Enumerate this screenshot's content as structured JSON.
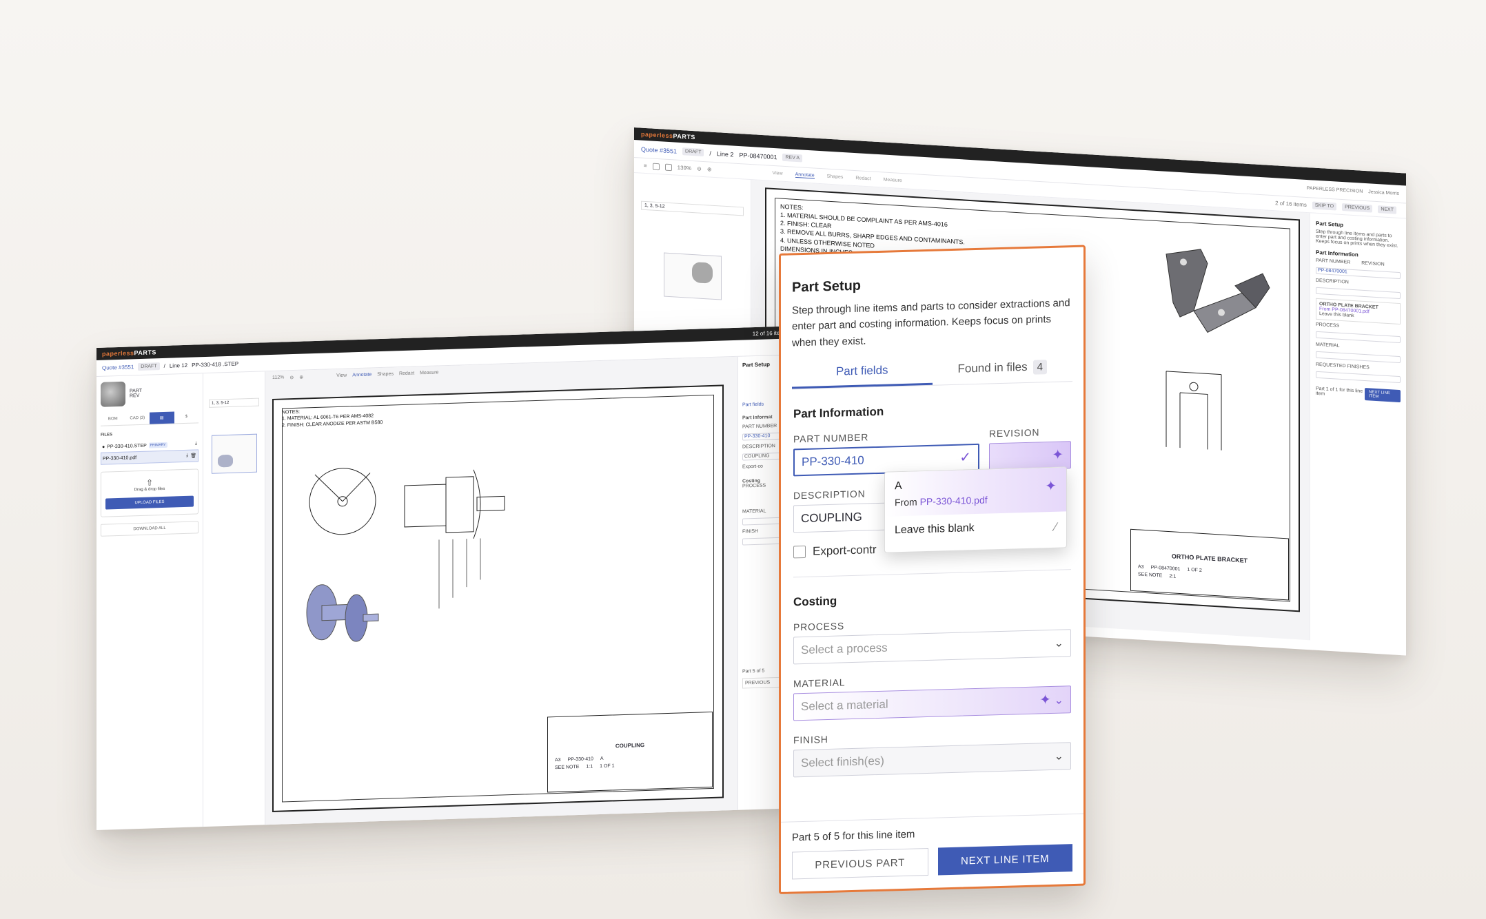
{
  "brand": {
    "logo_prefix": "paperless",
    "logo_suffix": "PARTS"
  },
  "back_window": {
    "quote": "Quote #3551",
    "status": "DRAFT",
    "line": "Line 2",
    "part_ref": "PP-08470001",
    "rev": "REV A",
    "org": "PAPERLESS PRECISION",
    "user": "Jessica Morris",
    "item_count": "2 of 16 items",
    "zoom": "139%",
    "nav_prev": "PREVIOUS",
    "nav_next": "NEXT",
    "skip_to": "SKIP TO",
    "page_field": "1, 3, 5-12",
    "tabs": [
      "View",
      "Annotate",
      "Shapes",
      "Redact",
      "Measure"
    ],
    "notes": [
      "NOTES:",
      "1. MATERIAL SHOULD BE COMPLAINT AS PER AMS-4016",
      "2. FINISH: CLEAR",
      "3. REMOVE ALL BURRS, SHARP EDGES AND CONTAMINANTS.",
      "4. UNLESS OTHERWISE NOTED",
      "   DIMENSIONS IN INCHES"
    ],
    "title_block": {
      "name": "ORTHO PLATE BRACKET",
      "part": "PP-08470001",
      "sheet": "1 OF 2",
      "size": "A3",
      "scale": "2:1",
      "note": "SEE NOTE"
    },
    "side": {
      "title": "Part Setup",
      "desc": "Step through line items and parts to enter part and costing information. Keeps focus on prints when they exist.",
      "section": "Part Information",
      "part_number_label": "PART NUMBER",
      "revision_label": "REVISION",
      "part_number": "PP-08470001",
      "revision": "A",
      "description_label": "DESCRIPTION",
      "suggest": "ORTHO PLATE BRACKET",
      "suggest_from": "From PP-08470001.pdf",
      "leave_blank": "Leave this blank",
      "process_label": "PROCESS",
      "material_label": "MATERIAL",
      "finish_label": "REQUESTED FINISHES",
      "footer": "Part 1 of 1 for this line item",
      "next": "NEXT LINE ITEM"
    }
  },
  "front_window": {
    "quote": "Quote #3551",
    "status": "DRAFT",
    "line": "Line 12",
    "part_ref": "PP-330-418 .STEP",
    "item_count": "12 of 16 items",
    "zoom": "112%",
    "page_field": "1, 3, 5-12",
    "tabs": [
      "View",
      "Annotate",
      "Shapes",
      "Redact",
      "Measure"
    ],
    "part_label": "PART",
    "rev_label": "REV",
    "left_tabs": [
      "BOM",
      "CAD (3)",
      "",
      "$"
    ],
    "files_header": "FILES",
    "files": [
      {
        "name": "PP-330-410.STEP",
        "badge": "PRIMARY"
      },
      {
        "name": "PP-330-410.pdf",
        "badge": ""
      }
    ],
    "dropzone_text": "Drag & drop files",
    "upload_label": "UPLOAD FILES",
    "download_all": "DOWNLOAD ALL",
    "notes": [
      "NOTES:",
      "1.    MATERIAL: AL 6061-T6 PER AMS-4082",
      "2.    FINISH: CLEAR ANODIZE PER ASTM B580"
    ],
    "title_block": {
      "name": "COUPLING",
      "part": "PP-330-410",
      "rev": "A",
      "size": "A3",
      "scale": "1:1",
      "sheet": "1 OF 1",
      "note": "SEE NOTE"
    },
    "side": {
      "title": "Part Setup",
      "tab": "Part fields",
      "info": "Part Informat",
      "pn": "PART NUMBER",
      "pn_val": "PP-330-410",
      "desc": "DESCRIPTION",
      "desc_val": "COUPLING",
      "export": "Export-co",
      "costing": "Costing",
      "process": "PROCESS",
      "material": "MATERIAL",
      "finish": "FINISH",
      "footer": "Part 5 of 5",
      "prev": "PREVIOUS"
    }
  },
  "panel": {
    "title": "Part Setup",
    "description": "Step through line items and parts to consider extractions and enter part and costing information. Keeps focus on prints when they exist.",
    "tabs": [
      {
        "label": "Part fields",
        "active": true
      },
      {
        "label": "Found in files",
        "count": "4",
        "active": false
      }
    ],
    "part_info_header": "Part Information",
    "part_number_label": "PART NUMBER",
    "part_number_value": "PP-330-410",
    "revision_label": "REVISION",
    "description_label": "DESCRIPTION",
    "description_value": "COUPLING",
    "export_label": "Export-contr",
    "dropdown": {
      "option_value": "A",
      "option_from_prefix": "From ",
      "option_from_file": "PP-330-410.pdf",
      "leave_blank": "Leave this blank"
    },
    "costing_header": "Costing",
    "process_label": "PROCESS",
    "process_placeholder": "Select a process",
    "material_label": "MATERIAL",
    "material_placeholder": "Select a material",
    "finish_label": "FINISH",
    "finish_placeholder": "Select finish(es)",
    "footer_text": "Part 5 of 5 for this line item",
    "previous_label": "PREVIOUS PART",
    "next_label": "NEXT LINE ITEM"
  },
  "colors": {
    "accent": "#3f5bb5",
    "highlight_border": "#e6793a",
    "ai_purple": "#7b55d6"
  },
  "icons": [
    "sparkle-icon",
    "chevron-down-icon",
    "check-sparkle-icon",
    "upload-icon",
    "download-icon",
    "trash-icon",
    "menu-icon",
    "search-icon"
  ]
}
